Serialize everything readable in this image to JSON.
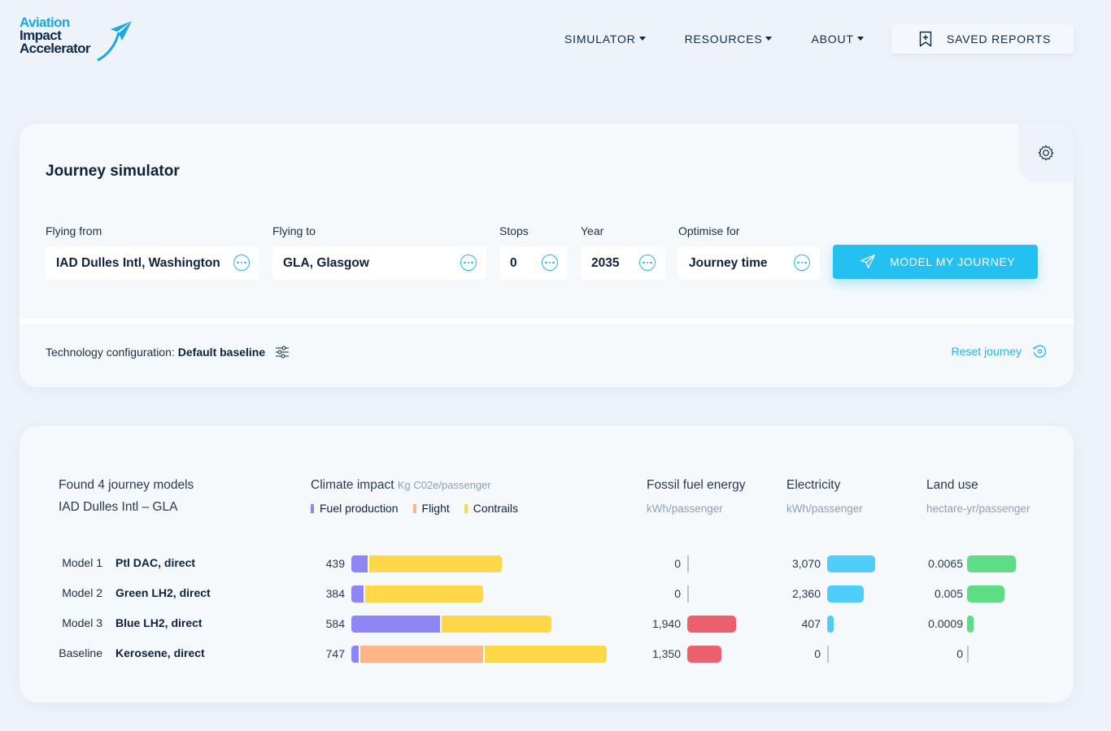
{
  "brand": {
    "line1": "Aviation",
    "line2": "Impact",
    "line3": "Accelerator"
  },
  "nav": {
    "items": [
      {
        "label": "SIMULATOR"
      },
      {
        "label": "RESOURCES"
      },
      {
        "label": "ABOUT"
      }
    ],
    "saved_reports": "SAVED REPORTS"
  },
  "simulator": {
    "title": "Journey simulator",
    "fields": {
      "from": {
        "label": "Flying from",
        "value": "IAD Dulles Intl, Washington"
      },
      "to": {
        "label": "Flying to",
        "value": "GLA, Glasgow"
      },
      "stops": {
        "label": "Stops",
        "value": "0"
      },
      "year": {
        "label": "Year",
        "value": "2035"
      },
      "optimise": {
        "label": "Optimise for",
        "value": "Journey time"
      }
    },
    "model_button": "MODEL MY JOURNEY",
    "tech_label": "Technology configuration:",
    "tech_value": "Default baseline",
    "reset": "Reset journey"
  },
  "results": {
    "found": "Found 4 journey models",
    "route": "IAD Dulles Intl – GLA",
    "columns": {
      "climate": {
        "title": "Climate impact",
        "unit": "Kg C02e/passenger"
      },
      "fossil": {
        "title": "Fossil fuel energy",
        "unit": "kWh/passenger"
      },
      "electricity": {
        "title": "Electricity",
        "unit": "kWh/passenger"
      },
      "land": {
        "title": "Land use",
        "unit": "hectare-yr/passenger"
      }
    },
    "legend": [
      {
        "label": "Fuel production",
        "color": "#8f86f5"
      },
      {
        "label": "Flight",
        "color": "#ffb585"
      },
      {
        "label": "Contrails",
        "color": "#ffd84a"
      }
    ],
    "colors": {
      "fossil": "#ec5f6d",
      "electricity": "#4dcdf7",
      "land": "#5fdc86"
    },
    "rows": [
      {
        "model": "Model 1",
        "name": "Ptl DAC, direct",
        "climate": "439",
        "fuel_production": 47,
        "flight": 0,
        "contrails": 392,
        "fossil": "0",
        "fossil_value": 0,
        "electricity": "3,070",
        "electricity_value": 3070,
        "land": "0.0065",
        "land_value": 0.0065
      },
      {
        "model": "Model 2",
        "name": "Green LH2, direct",
        "climate": "384",
        "fuel_production": 36,
        "flight": 0,
        "contrails": 348,
        "fossil": "0",
        "fossil_value": 0,
        "electricity": "2,360",
        "electricity_value": 2360,
        "land": "0.005",
        "land_value": 0.005
      },
      {
        "model": "Model 3",
        "name": "Blue LH2, direct",
        "climate": "584",
        "fuel_production": 259,
        "flight": 0,
        "contrails": 325,
        "fossil": "1,940",
        "fossil_value": 1940,
        "electricity": "407",
        "electricity_value": 407,
        "land": "0.0009",
        "land_value": 0.0009
      },
      {
        "model": "Baseline",
        "name": "Kerosene, direct",
        "climate": "747",
        "fuel_production": 22,
        "flight": 364,
        "contrails": 361,
        "fossil": "1,350",
        "fossil_value": 1350,
        "electricity": "0",
        "electricity_value": 0,
        "land": "0",
        "land_value": 0
      }
    ]
  }
}
